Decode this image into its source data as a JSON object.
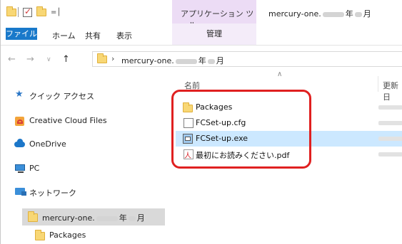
{
  "titlebar": {
    "context_tab": "アプリケーション ツール",
    "title_text": "mercury-one.",
    "title_year": "年",
    "title_month": "月"
  },
  "ribbon": {
    "tabs": [
      "ファイル",
      "ホーム",
      "共有",
      "表示"
    ],
    "manage": "管理"
  },
  "address": {
    "path_prefix": "mercury-one.",
    "year": "年",
    "month": "月"
  },
  "navpane": {
    "items": [
      {
        "label": "クイック アクセス",
        "icon": "star-icon"
      },
      {
        "label": "Creative Cloud Files",
        "icon": "creative-cloud-icon"
      },
      {
        "label": "OneDrive",
        "icon": "onedrive-cloud-icon"
      },
      {
        "label": "PC",
        "icon": "pc-icon"
      },
      {
        "label": "ネットワーク",
        "icon": "network-icon"
      }
    ],
    "selected": {
      "label_prefix": "mercury-one.",
      "year": "年",
      "month": "月"
    },
    "child": "Packages"
  },
  "columns": {
    "name": "名前",
    "modified": "更新日"
  },
  "files": [
    {
      "name": "Packages",
      "icon": "folder-icon"
    },
    {
      "name": "FCSet-up.cfg",
      "icon": "document-icon"
    },
    {
      "name": "FCSet-up.exe",
      "icon": "exe-icon"
    },
    {
      "name": "最初にお読みください.pdf",
      "icon": "pdf-icon"
    }
  ],
  "colors": {
    "file_tab": "#1979ca",
    "context_tab": "#ecdcf5",
    "selection": "#cce8ff",
    "annotation": "#e02020"
  }
}
